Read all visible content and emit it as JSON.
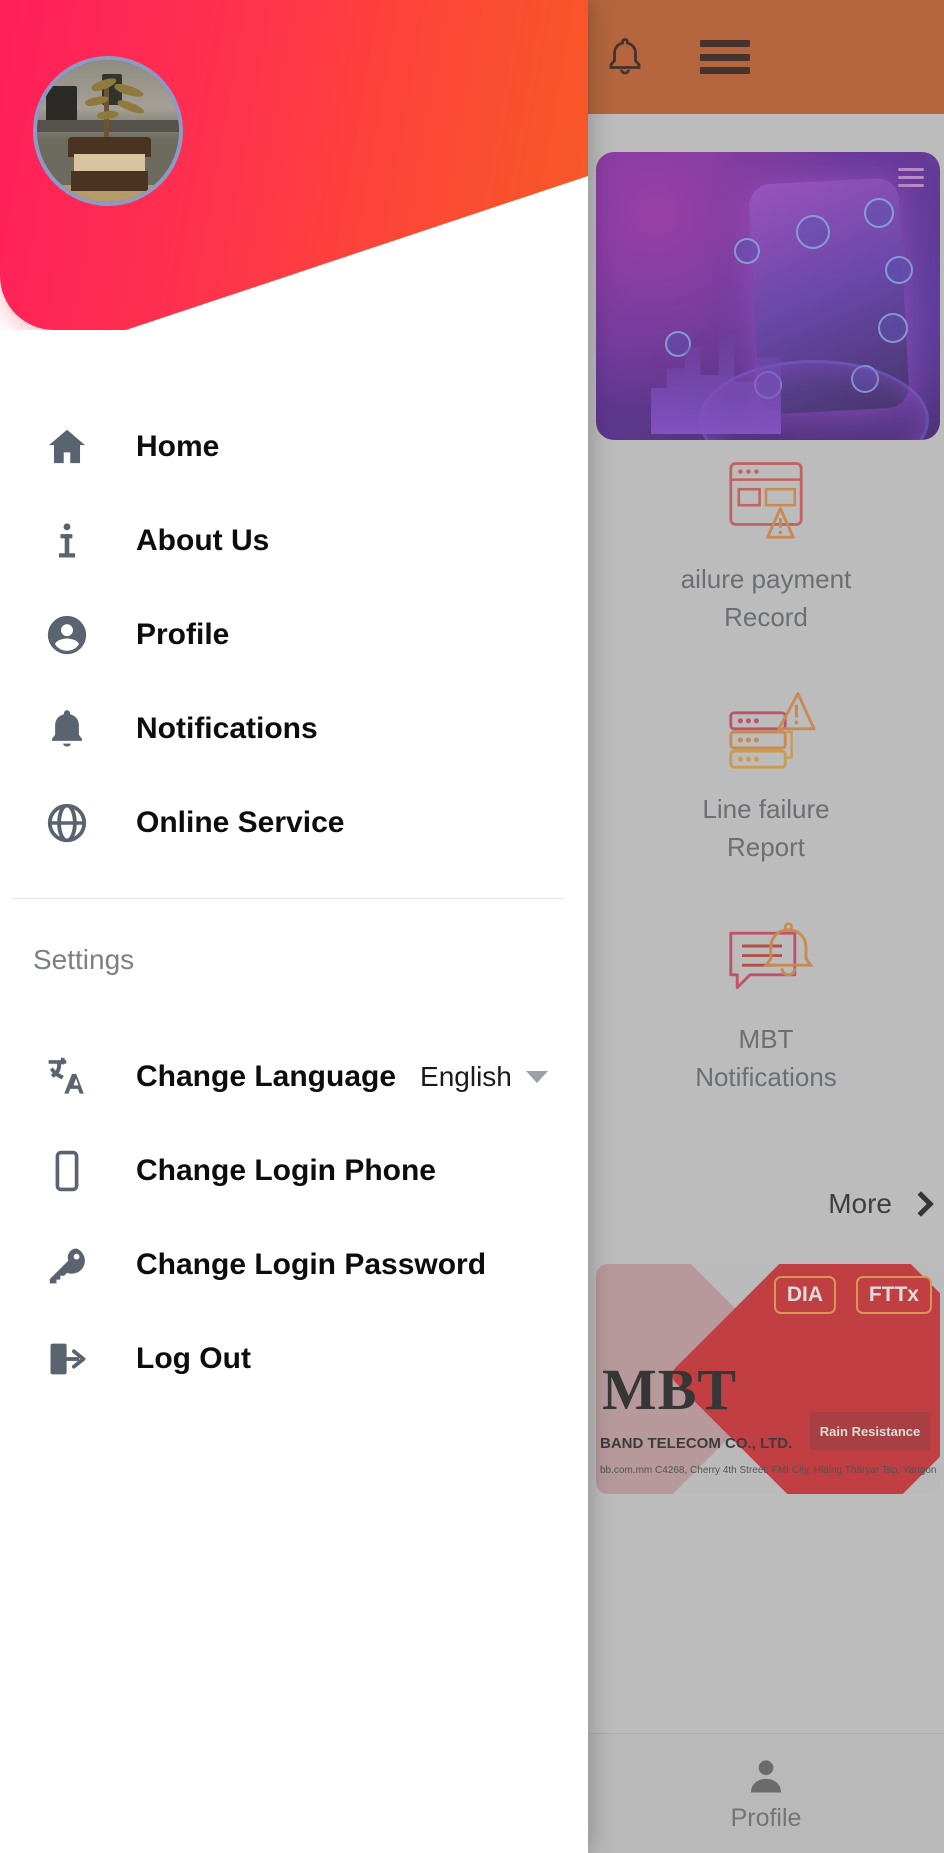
{
  "background_app": {
    "header": {
      "bell_icon": "bell-icon",
      "menu_icon": "hamburger-menu-icon"
    },
    "hero_card": {
      "name": "promo-banner"
    },
    "services": [
      {
        "icon": "payment-failure-icon",
        "label": "ailure payment\nRecord"
      },
      {
        "icon": "line-failure-icon",
        "label": "Line failure\nReport"
      },
      {
        "icon": "mbt-notification-icon",
        "label": "MBT\nNotifications"
      }
    ],
    "more_link": {
      "label": "More",
      "icon": "chevron-right-icon"
    },
    "banner": {
      "logo": "MBT",
      "badges": [
        "DIA",
        "FTTx"
      ],
      "stamp": "Rain Resistance",
      "company": "BAND TELECOM CO., LTD.",
      "address": "bb.com.mm   C4268, Cherry 4th Street, FMI City, Hlaing Tharyar Tsp, Yangon"
    },
    "bottom_nav": {
      "icon": "person-icon",
      "label": "Profile"
    }
  },
  "drawer": {
    "avatar": "user-avatar",
    "menu": [
      {
        "icon": "home-icon",
        "label": "Home"
      },
      {
        "icon": "info-icon",
        "label": "About Us"
      },
      {
        "icon": "account-circle-icon",
        "label": "Profile"
      },
      {
        "icon": "bell-icon",
        "label": "Notifications"
      },
      {
        "icon": "globe-icon",
        "label": "Online Service"
      }
    ],
    "settings_heading": "Settings",
    "settings": [
      {
        "icon": "translate-icon",
        "label": "Change Language",
        "value": "English"
      },
      {
        "icon": "phone-icon",
        "label": "Change Login Phone"
      },
      {
        "icon": "key-icon",
        "label": "Change Login Password"
      },
      {
        "icon": "logout-icon",
        "label": "Log Out"
      }
    ]
  },
  "colors": {
    "drawer_gradient_start": "#ff1f5a",
    "drawer_gradient_end": "#f4641c",
    "header_orange": "#c8571f",
    "icon_gray": "#5a6470",
    "label_black": "#0d0d0d",
    "muted_gray": "#7c8085"
  }
}
